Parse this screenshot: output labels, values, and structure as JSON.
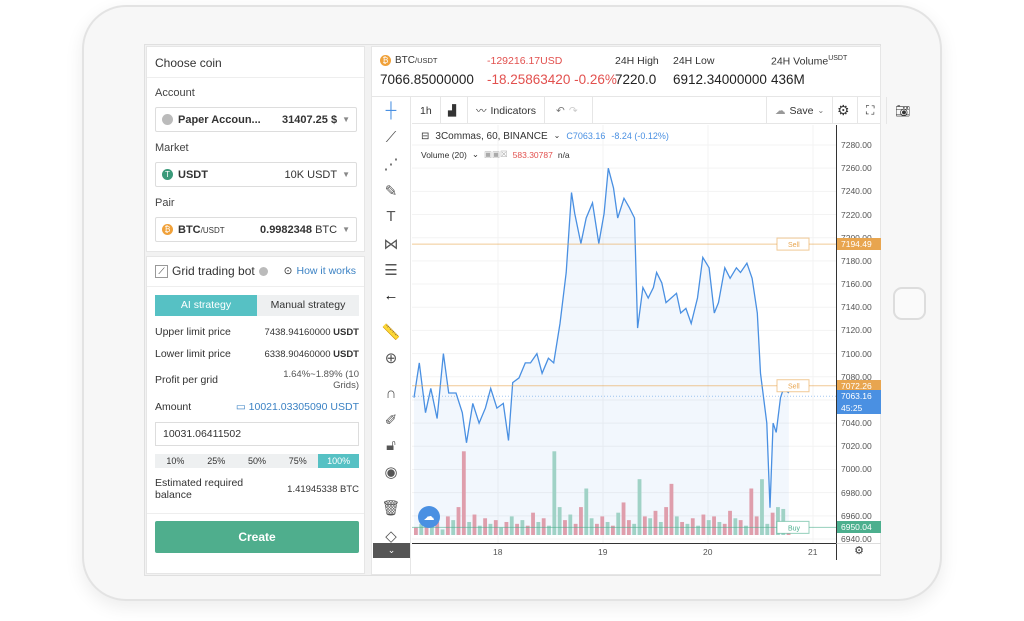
{
  "left": {
    "choose_coin": "Choose coin",
    "account_label": "Account",
    "account_value": "Paper Accoun...",
    "account_balance": "31407.25 $",
    "market_label": "Market",
    "market_value": "USDT",
    "market_balance": "10K USDT",
    "pair_label": "Pair",
    "pair_base": "BTC",
    "pair_quote": "/USDT",
    "pair_balance_num": "0.9982348",
    "pair_balance_unit": "BTC",
    "bot_title": "Grid trading bot",
    "how_it_works": "How it works",
    "tabs": [
      "AI strategy",
      "Manual strategy"
    ],
    "upper_label": "Upper limit price",
    "upper_value": "7438.94160000",
    "upper_unit": "USDT",
    "lower_label": "Lower limit price",
    "lower_value": "6338.90460000",
    "lower_unit": "USDT",
    "profit_label": "Profit per grid",
    "profit_value": "1.64%~1.89% (10 Grids)",
    "amount_label": "Amount",
    "amount_value": "10021.03305090 USDT",
    "amount_input": "10031.06411502",
    "percents": [
      "10%",
      "25%",
      "50%",
      "75%",
      "100%"
    ],
    "estimated_label": "Estimated required balance",
    "estimated_value": "1.41945338 BTC",
    "create": "Create"
  },
  "header": {
    "pair_base": "BTC",
    "pair_quote": "/USDT",
    "price": "7066.85000000",
    "change_usd": "-129216.17USD",
    "change": "-18.25863420 -0.26%",
    "high_label": "24H High",
    "high": "7220.0",
    "low_label": "24H Low",
    "low": "6912.34000000",
    "vol_label": "24H Volume",
    "vol_unit": "USDT",
    "vol": "436M"
  },
  "toolbar": {
    "interval": "1h",
    "indicators": "Indicators",
    "save": "Save"
  },
  "chart_data": {
    "type": "line",
    "legend_title": "3Commas, 60, BINANCE",
    "legend_close": "C7063.16",
    "legend_change": "-8.24 (-0.12%)",
    "volume_label": "Volume (20)",
    "volume_value": "583.30787",
    "volume_na": "n/a",
    "x_ticks": [
      "18",
      "19",
      "20",
      "21"
    ],
    "y_ticks": [
      "7280.00",
      "7260.00",
      "7240.00",
      "7220.00",
      "7200.00",
      "7180.00",
      "7160.00",
      "7140.00",
      "7120.00",
      "7100.00",
      "7080.00",
      "7060.00",
      "7040.00",
      "7020.00",
      "7000.00",
      "6980.00",
      "6960.00",
      "6940.00"
    ],
    "ylim": [
      6940,
      7285
    ],
    "xlim": [
      17.2,
      21.2
    ],
    "x": [
      17.2,
      17.25,
      17.31,
      17.36,
      17.42,
      17.48,
      17.53,
      17.6,
      17.66,
      17.7,
      17.76,
      17.82,
      17.88,
      17.93,
      17.99,
      18.05,
      18.1,
      18.14,
      18.2,
      18.26,
      18.31,
      18.37,
      18.42,
      18.48,
      18.53,
      18.59,
      18.65,
      18.7,
      18.73,
      18.79,
      18.84,
      18.9,
      18.96,
      19.01,
      19.05,
      19.1,
      19.14,
      19.2,
      19.25,
      19.3,
      19.33,
      19.38,
      19.43,
      19.48,
      19.51,
      19.56,
      19.6,
      19.65,
      19.7,
      19.74,
      19.79,
      19.84,
      19.9,
      19.95,
      20.01,
      20.06,
      20.1,
      20.16,
      20.21,
      20.27,
      20.31,
      20.37,
      20.42,
      20.47,
      20.5,
      20.56,
      20.59,
      20.62,
      20.65,
      20.69,
      20.72,
      20.77
    ],
    "y": [
      7062,
      7092,
      7049,
      7070,
      7044,
      7100,
      7066,
      7066,
      7049,
      7023,
      7057,
      7040,
      7053,
      7070,
      7053,
      7057,
      7025,
      7075,
      7079,
      7092,
      7092,
      7100,
      7083,
      7096,
      7092,
      7126,
      7170,
      7239,
      7221,
      7195,
      7217,
      7230,
      7195,
      7221,
      7260,
      7243,
      7217,
      7234,
      7226,
      7217,
      7122,
      7157,
      7148,
      7157,
      7170,
      7161,
      7144,
      7148,
      7152,
      7135,
      7139,
      7126,
      7148,
      7183,
      7174,
      7135,
      7144,
      7174,
      7165,
      7174,
      7170,
      7178,
      7165,
      7135,
      7083,
      7040,
      6967,
      7040,
      7032,
      7062,
      7070,
      7066
    ],
    "volume": [
      8,
      12,
      10,
      18,
      14,
      6,
      20,
      16,
      30,
      90,
      14,
      22,
      10,
      18,
      12,
      16,
      8,
      14,
      20,
      12,
      16,
      10,
      24,
      14,
      18,
      10,
      90,
      30,
      16,
      22,
      12,
      30,
      50,
      18,
      12,
      20,
      14,
      10,
      24,
      35,
      16,
      12,
      60,
      20,
      18,
      26,
      14,
      30,
      55,
      20,
      14,
      12,
      18,
      10,
      22,
      16,
      20,
      14,
      12,
      26,
      18,
      16,
      10,
      50,
      20,
      60,
      12,
      24,
      30,
      28,
      6
    ],
    "volume_up": [
      0,
      1,
      0,
      1,
      0,
      1,
      0,
      1,
      0,
      0,
      1,
      0,
      1,
      0,
      1,
      0,
      1,
      0,
      1,
      0,
      1,
      0,
      0,
      1,
      0,
      1,
      1,
      1,
      0,
      1,
      0,
      0,
      1,
      1,
      0,
      0,
      1,
      0,
      1,
      0,
      0,
      1,
      1,
      0,
      1,
      0,
      1,
      0,
      0,
      1,
      0,
      1,
      0,
      1,
      0,
      1,
      0,
      1,
      0,
      0,
      1,
      0,
      1,
      0,
      0,
      1,
      1,
      0,
      1,
      1,
      0
    ],
    "orders": [
      {
        "label": "Sell",
        "price": "7194.49",
        "color": "#e8a54f"
      },
      {
        "label": "Sell",
        "price": "7072.26",
        "color": "#e8a54f"
      },
      {
        "label": "Buy",
        "price": "6950.04",
        "color": "#4caf8e"
      }
    ],
    "last_price": "7063.16",
    "countdown": "45:25",
    "colors": {
      "line": "#4a90e2",
      "up": "#a7d8c4",
      "down": "#eba0a8"
    }
  }
}
